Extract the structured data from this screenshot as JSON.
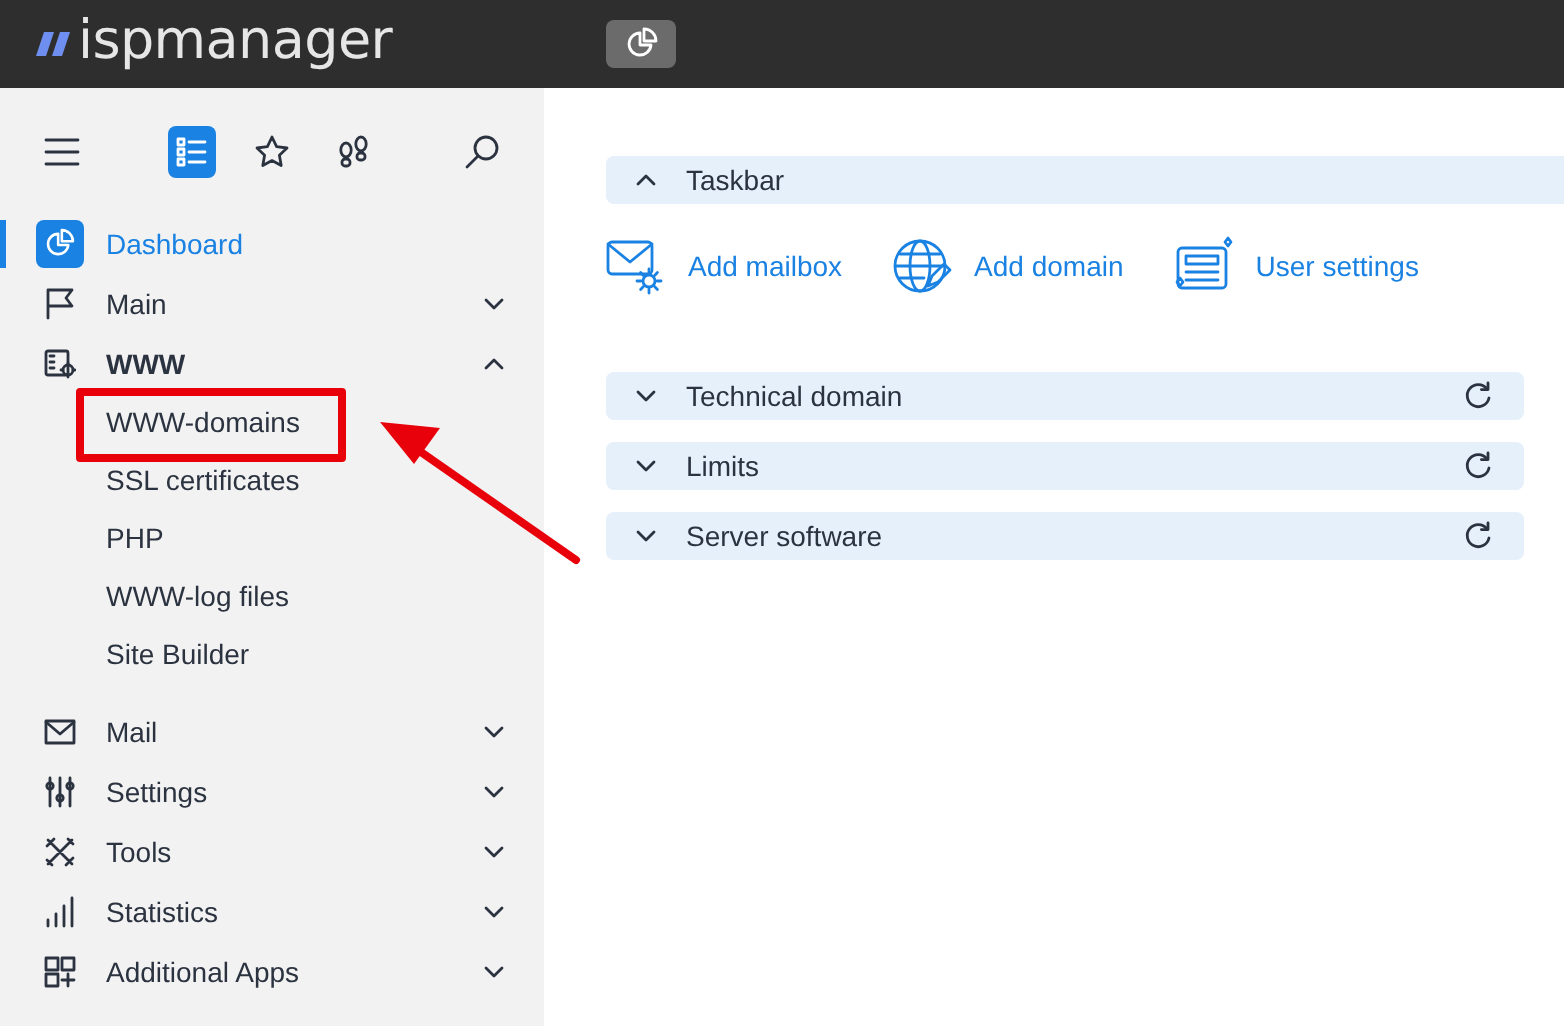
{
  "header": {
    "logo": "ispmanager"
  },
  "sidebar": {
    "tools": [
      {
        "kind": "menu",
        "selected": false
      },
      {
        "kind": "list",
        "selected": true
      },
      {
        "kind": "star",
        "selected": false
      },
      {
        "kind": "footprints",
        "selected": false
      },
      {
        "kind": "search",
        "selected": false
      }
    ],
    "nav": [
      {
        "label": "Dashboard",
        "kind": "dashboard",
        "selected": true
      },
      {
        "label": "Main",
        "kind": "flag",
        "selected": false,
        "expanded": false
      },
      {
        "label": "WWW",
        "kind": "www",
        "selected": false,
        "expanded": true,
        "children": [
          {
            "label": "WWW-domains",
            "highlighted": true
          },
          {
            "label": "SSL certificates",
            "highlighted": false
          },
          {
            "label": "PHP",
            "highlighted": false
          },
          {
            "label": "WWW-log files",
            "highlighted": false
          },
          {
            "label": "Site Builder",
            "highlighted": false
          }
        ]
      },
      {
        "label": "Mail",
        "kind": "mail",
        "selected": false,
        "expanded": false
      },
      {
        "label": "Settings",
        "kind": "sliders",
        "selected": false,
        "expanded": false
      },
      {
        "label": "Tools",
        "kind": "tools",
        "selected": false,
        "expanded": false
      },
      {
        "label": "Statistics",
        "kind": "bars",
        "selected": false,
        "expanded": false
      },
      {
        "label": "Additional Apps",
        "kind": "apps",
        "selected": false,
        "expanded": false
      }
    ]
  },
  "main": {
    "taskbar": {
      "title": "Taskbar",
      "expanded": true,
      "actions": [
        {
          "label": "Add mailbox",
          "kind": "mail-gear"
        },
        {
          "label": "Add domain",
          "kind": "globe-pen"
        },
        {
          "label": "User settings",
          "kind": "form"
        }
      ]
    },
    "sections": [
      {
        "title": "Technical domain",
        "expanded": false
      },
      {
        "title": "Limits",
        "expanded": false
      },
      {
        "title": "Server software",
        "expanded": false
      }
    ]
  }
}
